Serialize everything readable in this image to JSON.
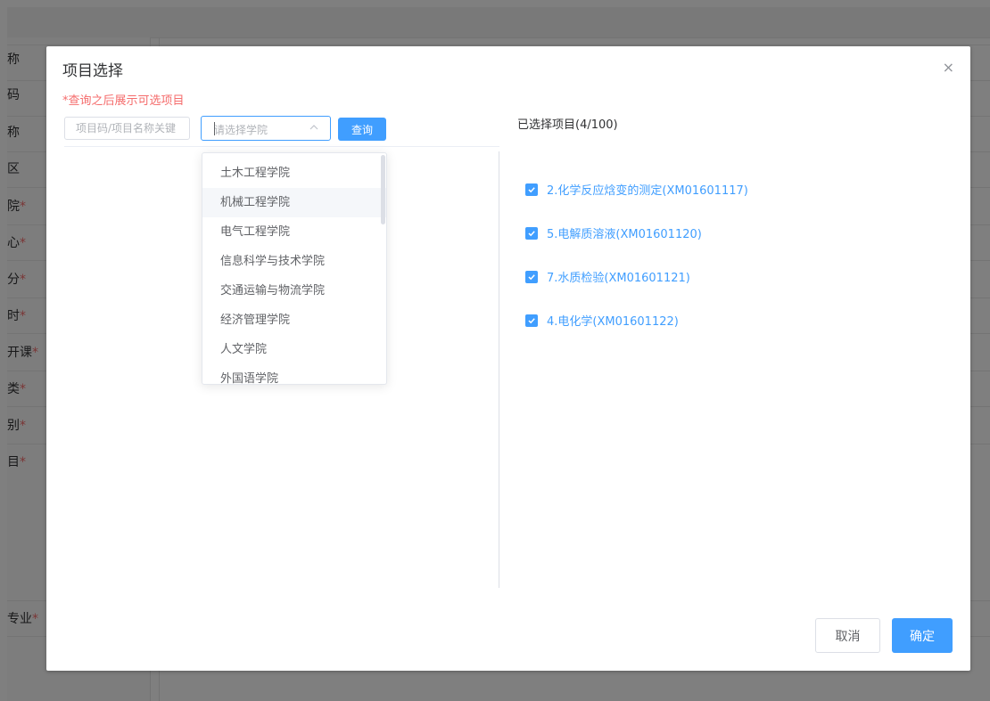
{
  "background": {
    "labels": [
      {
        "text": "称",
        "req": ""
      },
      {
        "text": "码",
        "req": ""
      },
      {
        "text": "称",
        "req": ""
      },
      {
        "text": "区",
        "req": ""
      },
      {
        "text": "院",
        "req": "*"
      },
      {
        "text": "心",
        "req": "*"
      },
      {
        "text": "分",
        "req": "*"
      },
      {
        "text": "时",
        "req": "*"
      },
      {
        "text": "开课",
        "req": "*"
      },
      {
        "text": "类",
        "req": "*"
      },
      {
        "text": "别",
        "req": "*"
      },
      {
        "text": "目",
        "req": "*"
      },
      {
        "text": "专业",
        "req": "*"
      }
    ]
  },
  "dialog": {
    "title": "项目选择",
    "close_icon": "×",
    "hint": "*查询之后展示可选项目",
    "keyword_placeholder": "项目码/项目名称关键",
    "college_select_placeholder": "请选择学院",
    "query_label": "查询",
    "selected_title": "已选择项目(4/100)",
    "selected_items": [
      "2.化学反应焓变的测定(XM01601117)",
      "5.电解质溶液(XM01601120)",
      "7.水质检验(XM01601121)",
      "4.电化学(XM01601122)"
    ],
    "cancel_label": "取消",
    "confirm_label": "确定"
  },
  "college_options": [
    "土木工程学院",
    "机械工程学院",
    "电气工程学院",
    "信息科学与技术学院",
    "交通运输与物流学院",
    "经济管理学院",
    "人文学院",
    "外国语学院"
  ],
  "colors": {
    "primary": "#409eff",
    "danger": "#f56c6c",
    "overlay": "rgba(0,0,0,0.5)"
  }
}
